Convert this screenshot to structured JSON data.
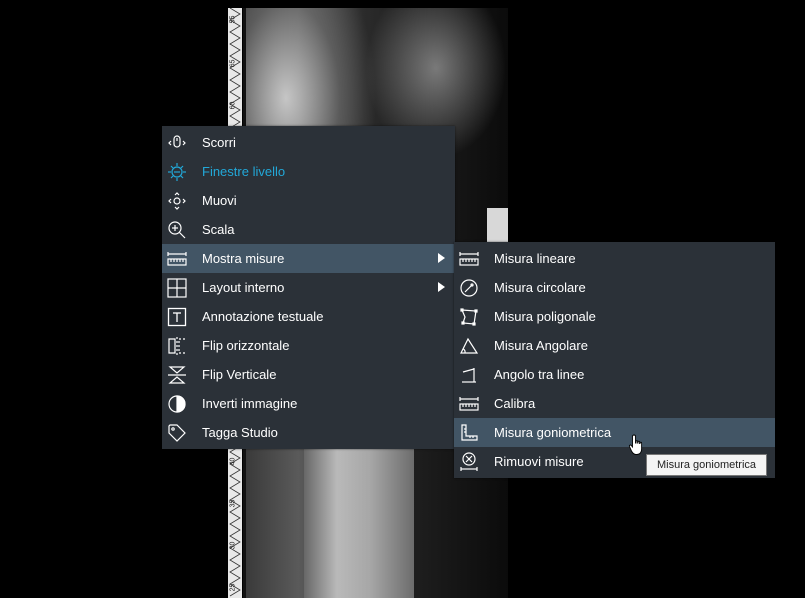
{
  "ruler": {
    "labels": [
      "55",
      "65",
      "60",
      "40",
      "35",
      "30",
      "25"
    ]
  },
  "menu": {
    "items": [
      {
        "label": "Scorri",
        "icon": "scroll-mouse-icon"
      },
      {
        "label": "Finestre livello",
        "icon": "window-level-icon",
        "active": true
      },
      {
        "label": "Muovi",
        "icon": "move-arrows-icon"
      },
      {
        "label": "Scala",
        "icon": "zoom-icon"
      },
      {
        "label": "Mostra misure",
        "icon": "ruler-icon",
        "submenu": true
      },
      {
        "label": "Layout interno",
        "icon": "grid-layout-icon",
        "submenu": true
      },
      {
        "label": "Annotazione testuale",
        "icon": "text-annotation-icon"
      },
      {
        "label": "Flip orizzontale",
        "icon": "flip-horizontal-icon"
      },
      {
        "label": "Flip Verticale",
        "icon": "flip-vertical-icon"
      },
      {
        "label": "Inverti immagine",
        "icon": "invert-image-icon"
      },
      {
        "label": "Tagga Studio",
        "icon": "tag-icon"
      }
    ]
  },
  "submenu": {
    "items": [
      {
        "label": "Misura lineare",
        "icon": "linear-measure-icon"
      },
      {
        "label": "Misura circolare",
        "icon": "circular-measure-icon"
      },
      {
        "label": "Misura poligonale",
        "icon": "polygon-measure-icon"
      },
      {
        "label": "Misura Angolare",
        "icon": "angle-measure-icon"
      },
      {
        "label": "Angolo tra linee",
        "icon": "angle-between-lines-icon"
      },
      {
        "label": "Calibra",
        "icon": "calibrate-icon"
      },
      {
        "label": "Misura goniometrica",
        "icon": "goniometric-measure-icon",
        "hover": true
      },
      {
        "label": "Rimuovi misure",
        "icon": "remove-measures-icon"
      }
    ]
  },
  "tooltip": "Misura goniometrica",
  "colors": {
    "menu_bg": "#2b3138",
    "hover_bg": "#425565",
    "active_text": "#22a8d8"
  }
}
